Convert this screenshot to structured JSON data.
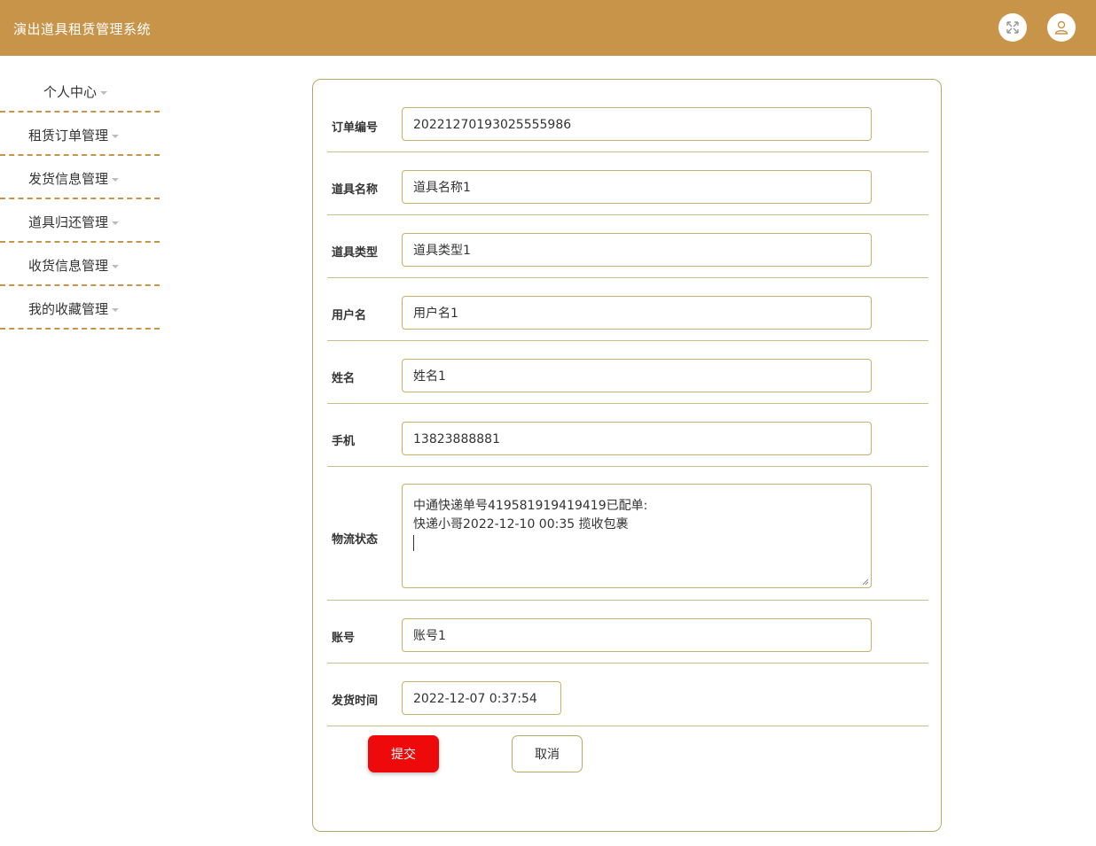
{
  "app": {
    "title": "演出道具租赁管理系统"
  },
  "header": {
    "fullscreen_icon": "fullscreen-icon",
    "user_icon": "user-icon"
  },
  "sidebar": {
    "items": [
      {
        "label": "个人中心"
      },
      {
        "label": "租赁订单管理"
      },
      {
        "label": "发货信息管理"
      },
      {
        "label": "道具归还管理"
      },
      {
        "label": "收货信息管理"
      },
      {
        "label": "我的收藏管理"
      }
    ]
  },
  "form": {
    "fields": [
      {
        "label": "订单编号",
        "value": "20221270193025555986"
      },
      {
        "label": "道具名称",
        "value": "道具名称1"
      },
      {
        "label": "道具类型",
        "value": "道具类型1"
      },
      {
        "label": "用户名",
        "value": "用户名1"
      },
      {
        "label": "姓名",
        "value": "姓名1"
      },
      {
        "label": "手机",
        "value": "13823888881"
      },
      {
        "label": "物流状态",
        "value": "中通快递单号419581919419419已配单:\n快递小哥2022-12-10 00:35 揽收包裹"
      },
      {
        "label": "账号",
        "value": "账号1"
      },
      {
        "label": "发货时间",
        "value": "2022-12-07 0:37:54"
      }
    ],
    "submit_label": "提交",
    "cancel_label": "取消"
  },
  "colors": {
    "header": "#c8944a",
    "submit": "#ee0a0a",
    "border": "#c7b06a"
  }
}
